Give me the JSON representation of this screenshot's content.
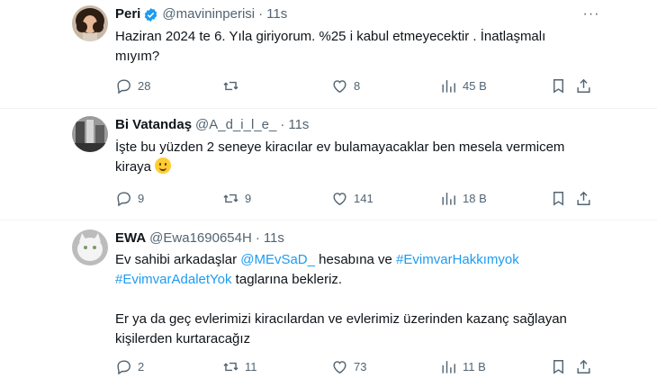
{
  "tweets": [
    {
      "name": "Peri",
      "handle": "@mavininperisi",
      "time": "11s",
      "verified": true,
      "text_lines": [
        "Haziran 2024 te 6. Yıla giriyorum. %25 i kabul etmeyecektir . İnatlaşmalı",
        "mıyım?"
      ],
      "replies": "28",
      "retweets": "",
      "likes": "8",
      "views": "45 B"
    },
    {
      "name": "Bi Vatandaş",
      "handle": "@A_d_i_l_e_",
      "time": "11s",
      "text_lines": [
        "İşte bu yüzden 2 seneye kiracılar ev bulamayacaklar ben mesela vermicem",
        "kiraya"
      ],
      "replies": "9",
      "retweets": "9",
      "likes": "141",
      "views": "18 B"
    },
    {
      "name": "EWA",
      "handle": "@Ewa1690654H",
      "time": "11s",
      "line1_a": "Ev sahibi arkadaşlar ",
      "mention": "@MEvSaD_",
      "line1_b": " hesabına ve ",
      "hashtag1": "#EvimvarHakkımyok",
      "hashtag2": "#EvimvarAdaletYok",
      "line2_b": " taglarına bekleriz.",
      "para2_lines": [
        "Er ya da geç evlerimizi kiracılardan ve evlerimiz üzerinden kazanç sağlayan",
        "kişilerden kurtaracağız"
      ],
      "replies": "2",
      "retweets": "11",
      "likes": "73",
      "views": "11 B"
    }
  ],
  "colors": {
    "link": "#1d9bf0",
    "verified": "#1d9bf0",
    "secondary": "#536471"
  },
  "icons": [
    "reply-icon",
    "retweet-icon",
    "like-icon",
    "views-icon",
    "bookmark-icon",
    "share-icon",
    "more-icon",
    "verified-badge-icon"
  ]
}
